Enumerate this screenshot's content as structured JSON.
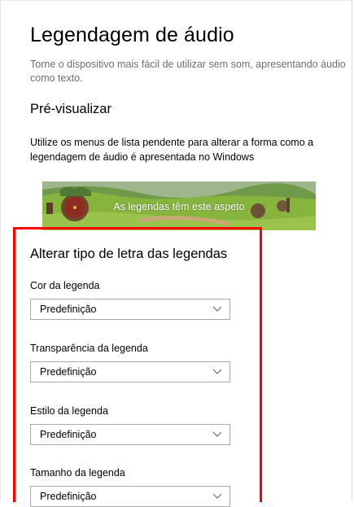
{
  "page": {
    "title": "Legendagem de áudio",
    "description": "Torne o dispositivo mais fácil de utilizar sem som, apresentando áudio como texto."
  },
  "preview": {
    "heading": "Pré-visualizar",
    "description": "Utilize os menus de lista pendente para alterar a forma como a legendagem de áudio é apresentada no Windows",
    "caption": "As legendas têm este aspeto"
  },
  "font_settings": {
    "heading": "Alterar tipo de letra das legendas",
    "fields": [
      {
        "label": "Cor da legenda",
        "value": "Predefinição"
      },
      {
        "label": "Transparência da legenda",
        "value": "Predefinição"
      },
      {
        "label": "Estilo da legenda",
        "value": "Predefinição"
      },
      {
        "label": "Tamanho da legenda",
        "value": "Predefinição"
      }
    ]
  },
  "icons": {
    "dropdown": "chevron-down-icon"
  },
  "colors": {
    "highlight": "#ff0000",
    "description_text": "#6d6d6d",
    "select_border": "#a9a9a9"
  }
}
